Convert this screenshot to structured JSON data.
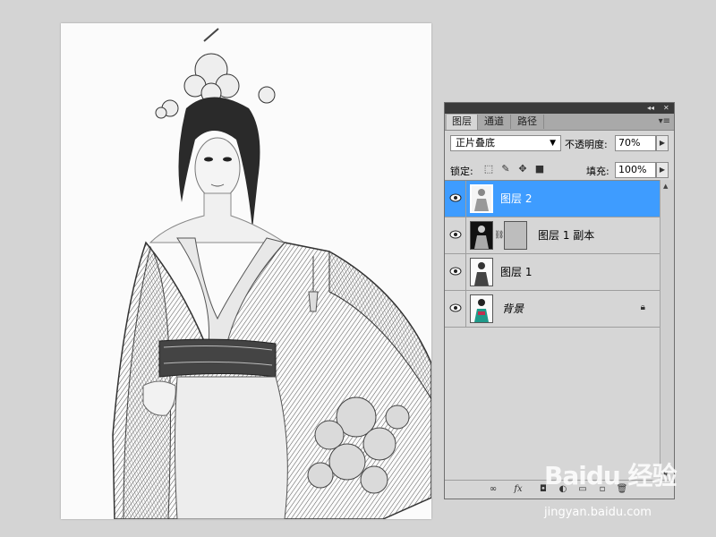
{
  "panel": {
    "tabs": [
      "图层",
      "通道",
      "路径"
    ],
    "blend_mode": "正片叠底",
    "opacity_label": "不透明度:",
    "opacity_value": "70%",
    "lock_label": "锁定:",
    "fill_label": "填充:",
    "fill_value": "100%",
    "layers": [
      {
        "name": "图层 2",
        "selected": true,
        "visible": true
      },
      {
        "name": "图层 1 副本",
        "selected": false,
        "visible": true,
        "has_mask": true
      },
      {
        "name": "图层 1",
        "selected": false,
        "visible": true
      },
      {
        "name": "背景",
        "selected": false,
        "visible": true,
        "locked": true
      }
    ],
    "bottom_icons": [
      "link-icon",
      "fx-icon",
      "mask-icon",
      "adjustment-icon",
      "folder-icon",
      "new-layer-icon",
      "trash-icon"
    ]
  },
  "watermark": {
    "brand": "Baidu 经验",
    "url": "jingyan.baidu.com"
  },
  "colors": {
    "selection": "#3e9cff",
    "panel_bg": "#d6d6d6",
    "workspace_bg": "#d4d4d4"
  }
}
